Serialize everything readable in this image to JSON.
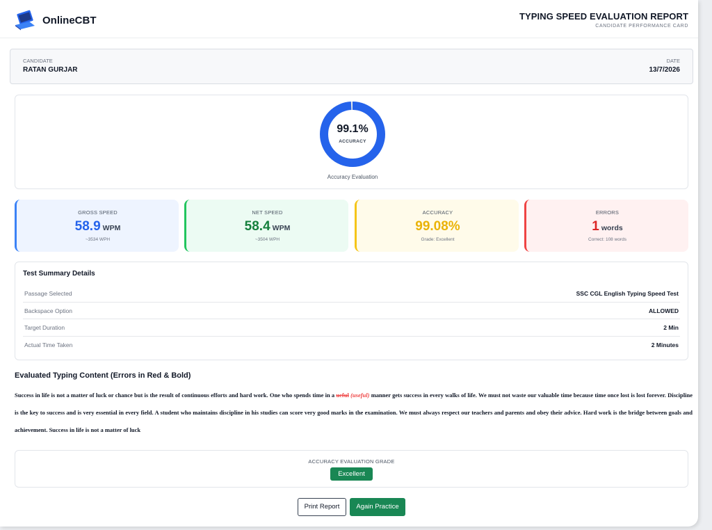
{
  "header": {
    "brand": "OnlineCBT",
    "report_title": "TYPING SPEED EVALUATION REPORT",
    "report_subtitle": "CANDIDATE PERFORMANCE CARD"
  },
  "candidate": {
    "label": "CANDIDATE",
    "name": "RATAN GURJAR",
    "date_label": "DATE",
    "date": "13/7/2026"
  },
  "accuracy_chart": {
    "value_text": "99.1%",
    "label": "ACCURACY",
    "caption": "Accuracy Evaluation",
    "accuracy_percent": 99.08,
    "color_main": "#2563eb",
    "color_rest": "#e5e7eb"
  },
  "stats": {
    "gross": {
      "label": "GROSS SPEED",
      "value": "58.9",
      "unit": "WPM",
      "sub": "~3534 WPH",
      "color": "#2563eb"
    },
    "net": {
      "label": "NET SPEED",
      "value": "58.4",
      "unit": "WPM",
      "sub": "~3504 WPH",
      "color": "#15803d"
    },
    "accuracy": {
      "label": "ACCURACY",
      "value": "99.08%",
      "sub": "Grade: Excellent",
      "color": "#eab308"
    },
    "errors": {
      "label": "ERRORS",
      "value": "1",
      "unit": "words",
      "sub": "Correct: 108 words",
      "color": "#dc2626"
    }
  },
  "summary": {
    "title": "Test Summary Details",
    "rows": [
      {
        "key": "Passage Selected",
        "value": "SSC CGL English Typing Speed Test"
      },
      {
        "key": "Backspace Option",
        "value": "ALLOWED"
      },
      {
        "key": "Target Duration",
        "value": "2 Min"
      },
      {
        "key": "Actual Time Taken",
        "value": "2 Minutes"
      }
    ]
  },
  "content": {
    "title": "Evaluated Typing Content (Errors in Red & Bold)",
    "before": "Success in life is not a matter of luck or chance but is the result of continuous efforts and hard work. One who spends time in a ",
    "error_word": "ueful",
    "error_fix": "(useful)",
    "after": " manner gets success in every walks of life. We must not waste our valuable time because time once lost is lost forever. Discipline is the key to success and is very essential in every field. A student who maintains discipline in his studies can score very good marks in the examination. We must always respect our teachers and parents and obey their advice. Hard work is the bridge between goals and achievement. Success in life is not a matter of luck"
  },
  "grade": {
    "label": "ACCURACY EVALUATION GRADE",
    "value": "Excellent",
    "color": "#198754"
  },
  "actions": {
    "print_label": "Print Report",
    "again_label": "Again Practice"
  }
}
